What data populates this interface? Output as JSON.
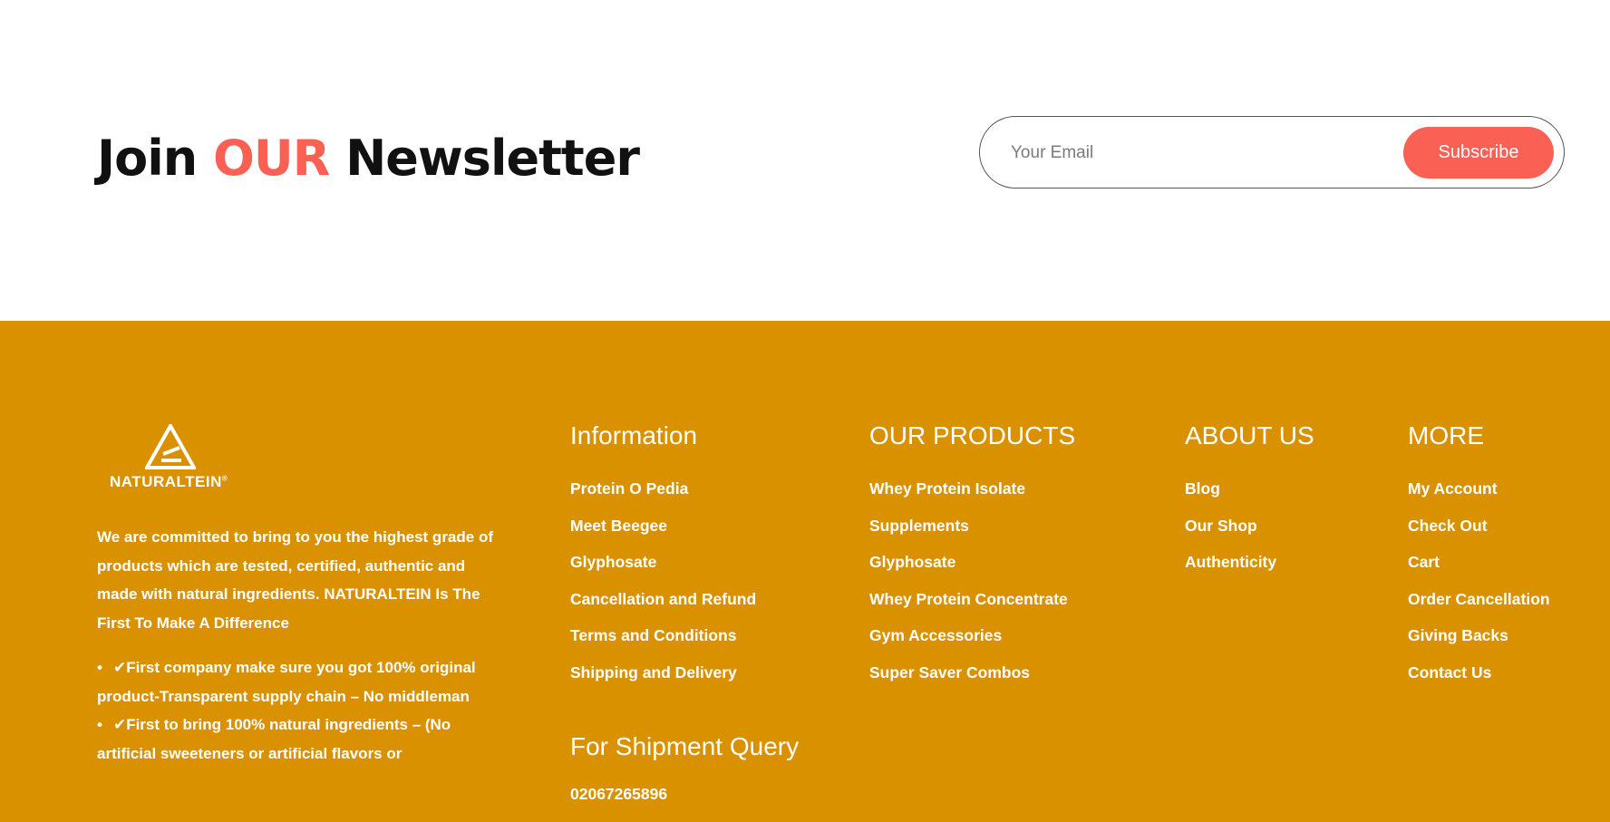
{
  "newsletter": {
    "title_before": "Join ",
    "title_accent": "OUR",
    "title_after": " Newsletter",
    "email_placeholder": "Your Email",
    "subscribe_label": "Subscribe"
  },
  "brand": {
    "name": "NATURALTEIN",
    "registered_mark": "®",
    "accent_color": "#fb6054",
    "footer_color": "#d99100"
  },
  "about": {
    "text": "We are committed to bring to you the highest grade of products which are tested, certified, authentic and made with natural ingredients. NATURALTEIN Is The First To Make A Difference",
    "points": [
      "✔First company make sure you got 100% original product-Transparent supply chain – No middleman",
      "✔First to bring 100% natural ingredients – (No artificial sweeteners or artificial flavors or"
    ]
  },
  "information": {
    "title": "Information",
    "links": [
      "Protein O Pedia",
      "Meet Beegee",
      "Glyphosate",
      "Cancellation and Refund",
      "Terms and Conditions",
      "Shipping and Delivery"
    ]
  },
  "products": {
    "title": "OUR PRODUCTS",
    "links": [
      "Whey Protein Isolate",
      "Supplements",
      "Glyphosate",
      "Whey Protein Concentrate",
      "Gym Accessories",
      "Super Saver Combos"
    ]
  },
  "about_us": {
    "title": "ABOUT US",
    "links": [
      "Blog",
      "Our Shop",
      "Authenticity"
    ]
  },
  "more": {
    "title": "MORE",
    "links": [
      "My Account",
      "Check Out",
      "Cart",
      "Order Cancellation",
      "Giving Backs",
      "Contact Us"
    ]
  },
  "shipment": {
    "title": "For Shipment Query",
    "phone": "02067265896"
  }
}
